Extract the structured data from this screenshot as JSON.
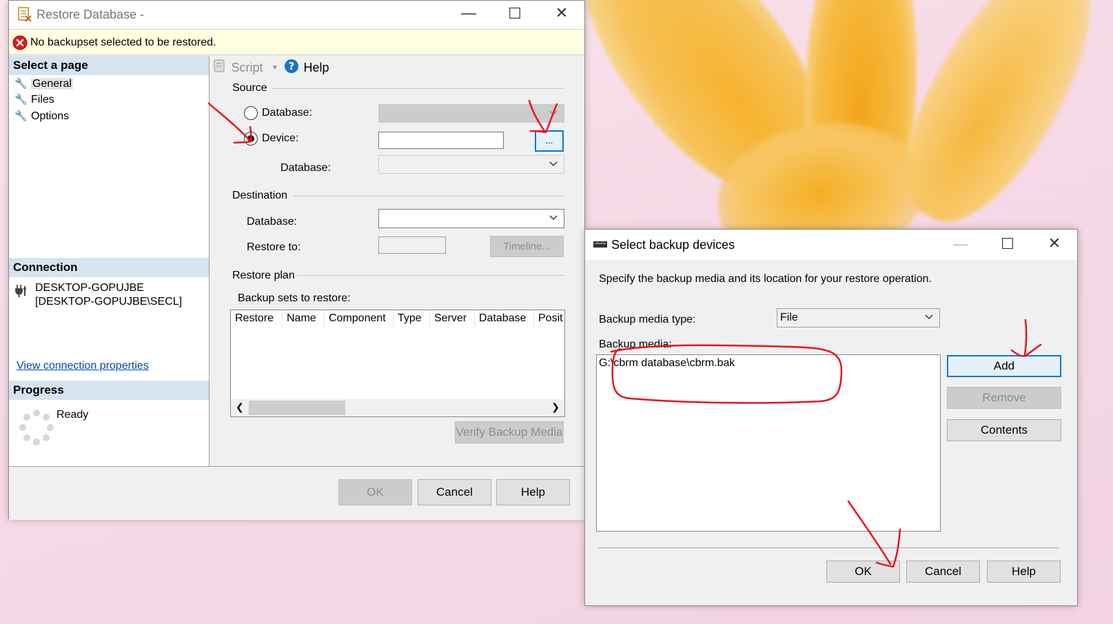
{
  "restore_window": {
    "title": "Restore Database -",
    "error_message": "No backupset selected to be restored.",
    "toolbar": {
      "script_label": "Script",
      "help_label": "Help"
    },
    "select_page": {
      "header": "Select a page",
      "items": [
        {
          "label": "General"
        },
        {
          "label": "Files"
        },
        {
          "label": "Options"
        }
      ]
    },
    "connection": {
      "header": "Connection",
      "server": "DESKTOP-GOPUJBE",
      "user": "[DESKTOP-GOPUJBE\\SECL]",
      "link": "View connection properties"
    },
    "progress": {
      "header": "Progress",
      "status": "Ready"
    },
    "source": {
      "header": "Source",
      "database_radio_label": "Database:",
      "device_radio_label": "Device:",
      "device_value": "",
      "browse_label": "...",
      "database_label": "Database:",
      "selected_option": "Device"
    },
    "destination": {
      "header": "Destination",
      "database_label": "Database:",
      "restore_to_label": "Restore to:",
      "timeline_label": "Timeline..."
    },
    "restore_plan": {
      "header": "Restore plan",
      "backup_sets_label": "Backup sets to restore:",
      "columns": [
        "Restore",
        "Name",
        "Component",
        "Type",
        "Server",
        "Database",
        "Posit"
      ],
      "verify_label": "Verify Backup Media"
    },
    "buttons": {
      "ok": "OK",
      "cancel": "Cancel",
      "help": "Help"
    }
  },
  "backup_devices_dialog": {
    "title": "Select backup devices",
    "description": "Specify the backup media and its location for your restore operation.",
    "media_type_label": "Backup media type:",
    "media_type_value": "File",
    "media_label": "Backup media:",
    "media_items": [
      "G:\\cbrm database\\cbrm.bak"
    ],
    "side_buttons": {
      "add": "Add",
      "remove": "Remove",
      "contents": "Contents"
    },
    "buttons": {
      "ok": "OK",
      "cancel": "Cancel",
      "help": "Help"
    }
  },
  "colors": {
    "accent": "#0078d7",
    "annotation": "#e8141c",
    "error_bar": "#ffffe1",
    "section_header": "#d6e3f1"
  }
}
